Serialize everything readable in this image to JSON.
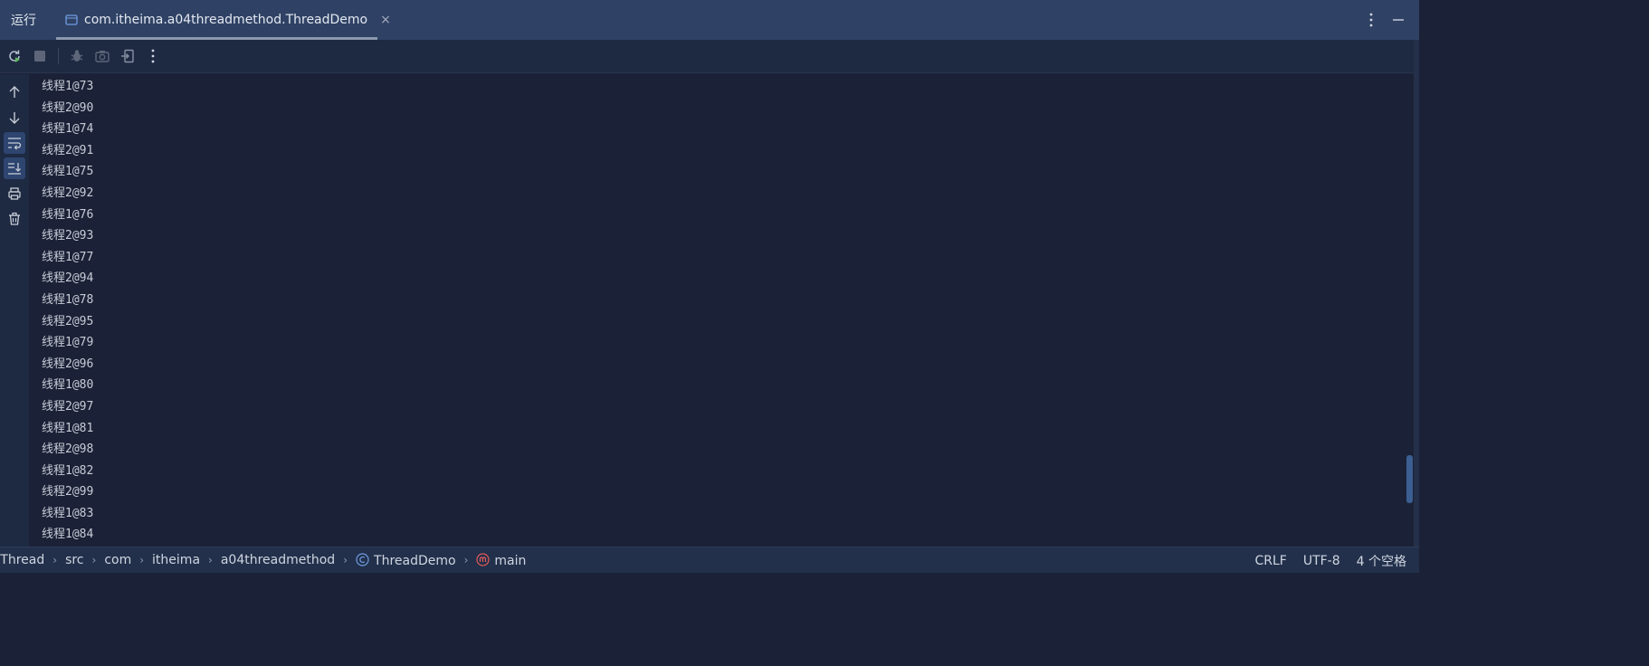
{
  "tabbar": {
    "run_title": "运行",
    "active_tab": "com.itheima.a04threadmethod.ThreadDemo",
    "close_glyph": "×",
    "more_glyph": "⋮",
    "minimize_glyph": "—"
  },
  "toolbar": {
    "buttons": [
      "rerun-icon",
      "stop-icon",
      "debug-icon",
      "screenshot-icon",
      "exit-icon",
      "more-icon"
    ]
  },
  "sidebar": {
    "buttons": [
      "up-arrow-icon",
      "down-arrow-icon",
      "soft-wrap-icon",
      "scroll-to-end-icon",
      "print-icon",
      "trash-icon"
    ]
  },
  "console": {
    "lines": [
      "线程1@73",
      "线程2@90",
      "线程1@74",
      "线程2@91",
      "线程1@75",
      "线程2@92",
      "线程1@76",
      "线程2@93",
      "线程1@77",
      "线程2@94",
      "线程1@78",
      "线程2@95",
      "线程1@79",
      "线程2@96",
      "线程1@80",
      "线程2@97",
      "线程1@81",
      "线程2@98",
      "线程1@82",
      "线程2@99",
      "线程1@83",
      "线程1@84"
    ]
  },
  "statusbar": {
    "breadcrumbs": {
      "project": "yThread",
      "src": "src",
      "com": "com",
      "itheima": "itheima",
      "package": "a04threadmethod",
      "class": "ThreadDemo",
      "method": "main"
    },
    "separator": "›",
    "line_ending": "CRLF",
    "encoding": "UTF-8",
    "indent": "4 个空格"
  },
  "colors": {
    "tabbar_bg": "#2f4265",
    "console_bg": "#1b2237",
    "status_bg": "#22304b",
    "accent": "#3b5f92"
  }
}
